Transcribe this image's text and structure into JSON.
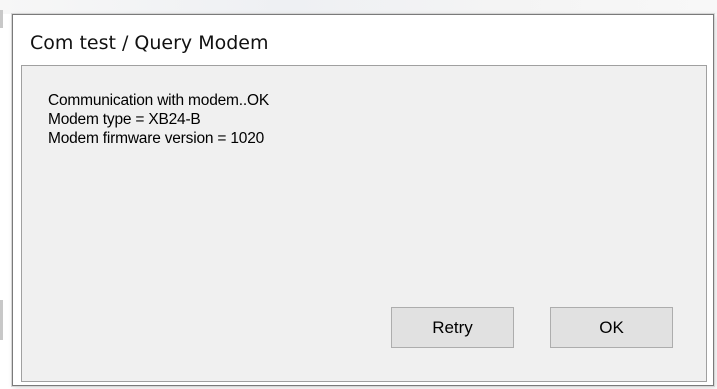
{
  "dialog": {
    "title": "Com test / Query Modem",
    "lines": [
      "Communication with modem..OK",
      "Modem type = XB24-B",
      "Modem firmware version = 1020"
    ],
    "buttons": {
      "retry_label": "Retry",
      "ok_label": "OK"
    }
  },
  "colors": {
    "client_background": "#f0f0f0",
    "button_face": "#e1e1e1",
    "title_text": "#111111"
  }
}
